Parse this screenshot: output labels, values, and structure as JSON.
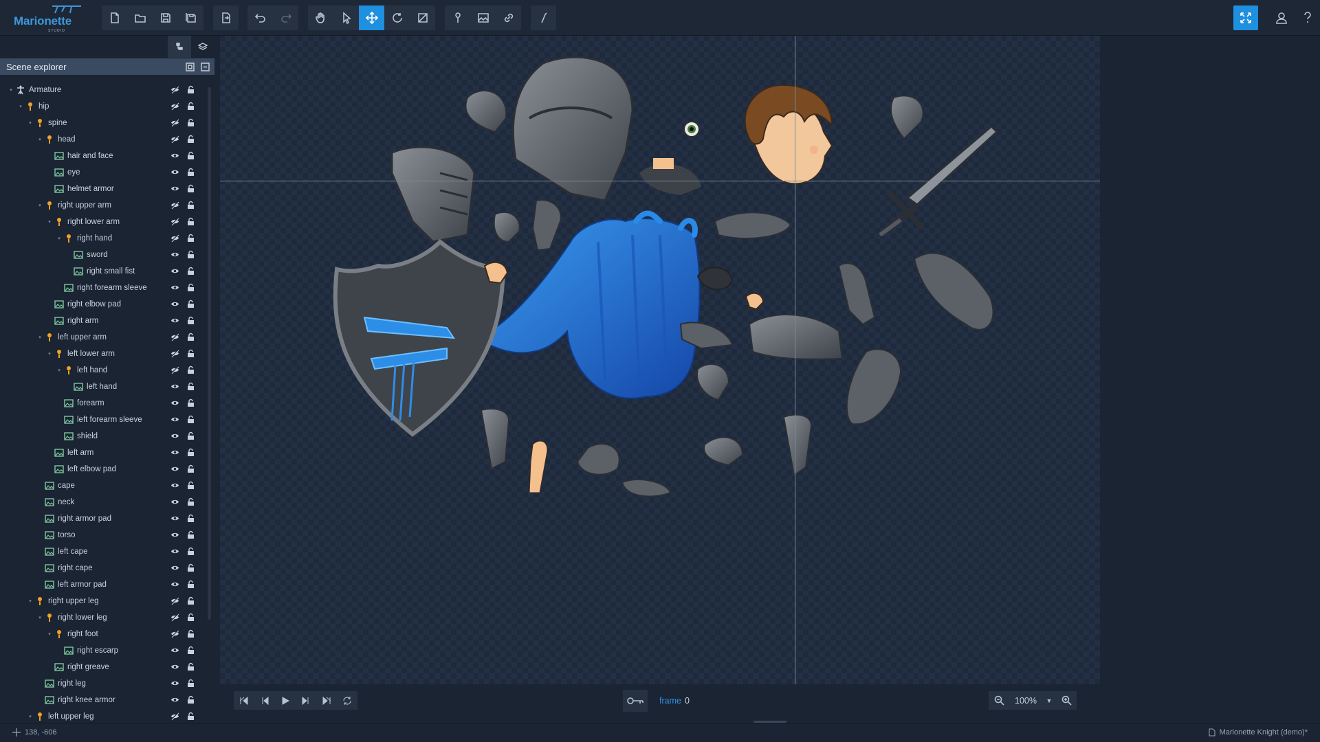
{
  "app": {
    "logo_text": "Marionette",
    "logo_sub": "STUDIO"
  },
  "toolbar": {
    "file_buttons": [
      {
        "name": "new-document-button",
        "icon": "new-file-icon"
      },
      {
        "name": "open-button",
        "icon": "folder-open-icon"
      },
      {
        "name": "save-button",
        "icon": "save-icon"
      },
      {
        "name": "save-as-button",
        "icon": "save-as-icon"
      }
    ],
    "export_button": {
      "icon": "export-icon"
    },
    "history_buttons": [
      {
        "name": "undo-button",
        "icon": "undo-icon"
      },
      {
        "name": "redo-button",
        "icon": "redo-icon"
      }
    ],
    "tool_buttons": [
      {
        "name": "pan-tool-button",
        "icon": "hand-icon"
      },
      {
        "name": "select-tool-button",
        "icon": "cursor-icon"
      },
      {
        "name": "move-tool-button",
        "icon": "move-icon",
        "active": true
      },
      {
        "name": "rotate-tool-button",
        "icon": "rotate-icon"
      },
      {
        "name": "scale-tool-button",
        "icon": "scale-icon"
      }
    ],
    "create_buttons": [
      {
        "name": "add-bone-button",
        "icon": "bone-pin-icon"
      },
      {
        "name": "add-image-button",
        "icon": "image-icon"
      },
      {
        "name": "link-button",
        "icon": "link-icon"
      }
    ],
    "ik_button": {
      "icon": "ik-icon"
    },
    "right": [
      {
        "name": "fullscreen-button",
        "icon": "fullscreen-icon"
      },
      {
        "name": "account-button",
        "icon": "user-icon"
      },
      {
        "name": "help-button",
        "icon": "help-icon"
      }
    ]
  },
  "scene_explorer": {
    "title": "Scene explorer",
    "tabs": [
      "hierarchy-tab",
      "layers-tab"
    ],
    "items": [
      {
        "label": "Armature",
        "type": "armature",
        "depth": 0,
        "expanded": true
      },
      {
        "label": "hip",
        "type": "bone",
        "depth": 1,
        "expanded": true
      },
      {
        "label": "spine",
        "type": "bone",
        "depth": 2,
        "expanded": true
      },
      {
        "label": "head",
        "type": "bone",
        "depth": 3,
        "expanded": true
      },
      {
        "label": "hair and face",
        "type": "image",
        "depth": 4
      },
      {
        "label": "eye",
        "type": "image",
        "depth": 4
      },
      {
        "label": "helmet armor",
        "type": "image",
        "depth": 4
      },
      {
        "label": "right upper arm",
        "type": "bone",
        "depth": 3,
        "expanded": true
      },
      {
        "label": "right lower arm",
        "type": "bone",
        "depth": 4,
        "expanded": true
      },
      {
        "label": "right hand",
        "type": "bone",
        "depth": 5,
        "expanded": true
      },
      {
        "label": "sword",
        "type": "image",
        "depth": 6
      },
      {
        "label": "right small fist",
        "type": "image",
        "depth": 6
      },
      {
        "label": "right forearm sleeve",
        "type": "image",
        "depth": 5
      },
      {
        "label": "right elbow pad",
        "type": "image",
        "depth": 4
      },
      {
        "label": "right arm",
        "type": "image",
        "depth": 4
      },
      {
        "label": "left upper arm",
        "type": "bone",
        "depth": 3,
        "expanded": true
      },
      {
        "label": "left lower arm",
        "type": "bone",
        "depth": 4,
        "expanded": true
      },
      {
        "label": "left hand",
        "type": "bone",
        "depth": 5,
        "expanded": true
      },
      {
        "label": "left hand",
        "type": "image",
        "depth": 6
      },
      {
        "label": "forearm",
        "type": "image",
        "depth": 5
      },
      {
        "label": "left forearm sleeve",
        "type": "image",
        "depth": 5
      },
      {
        "label": "shield",
        "type": "image",
        "depth": 5
      },
      {
        "label": "left arm",
        "type": "image",
        "depth": 4
      },
      {
        "label": "left elbow pad",
        "type": "image",
        "depth": 4
      },
      {
        "label": "cape",
        "type": "image",
        "depth": 3
      },
      {
        "label": "neck",
        "type": "image",
        "depth": 3
      },
      {
        "label": "right armor pad",
        "type": "image",
        "depth": 3
      },
      {
        "label": "torso",
        "type": "image",
        "depth": 3
      },
      {
        "label": "left cape",
        "type": "image",
        "depth": 3
      },
      {
        "label": "right cape",
        "type": "image",
        "depth": 3
      },
      {
        "label": "left armor pad",
        "type": "image",
        "depth": 3
      },
      {
        "label": "right upper leg",
        "type": "bone",
        "depth": 2,
        "expanded": true
      },
      {
        "label": "right lower leg",
        "type": "bone",
        "depth": 3,
        "expanded": true
      },
      {
        "label": "right foot",
        "type": "bone",
        "depth": 4,
        "expanded": true
      },
      {
        "label": "right escarp",
        "type": "image",
        "depth": 5
      },
      {
        "label": "right greave",
        "type": "image",
        "depth": 4
      },
      {
        "label": "right leg",
        "type": "image",
        "depth": 3
      },
      {
        "label": "right knee armor",
        "type": "image",
        "depth": 3
      },
      {
        "label": "left upper leg",
        "type": "bone",
        "depth": 2,
        "expanded": true
      }
    ]
  },
  "playback": {
    "buttons": [
      {
        "name": "first-frame-button",
        "icon": "skip-start-icon"
      },
      {
        "name": "prev-frame-button",
        "icon": "step-back-icon"
      },
      {
        "name": "play-button",
        "icon": "play-icon"
      },
      {
        "name": "next-frame-button",
        "icon": "step-forward-icon"
      },
      {
        "name": "last-frame-button",
        "icon": "skip-end-icon"
      },
      {
        "name": "loop-button",
        "icon": "loop-icon"
      }
    ],
    "frame_label": "frame",
    "frame_value": "0"
  },
  "zoom": {
    "value": "100%"
  },
  "status": {
    "coords": "138, -606",
    "document": "Marionette Knight (demo)*"
  },
  "colors": {
    "accent": "#1f8fe0",
    "bone": "#f0a126",
    "image": "#7fc8a0",
    "cape": "#1f6fd1"
  }
}
